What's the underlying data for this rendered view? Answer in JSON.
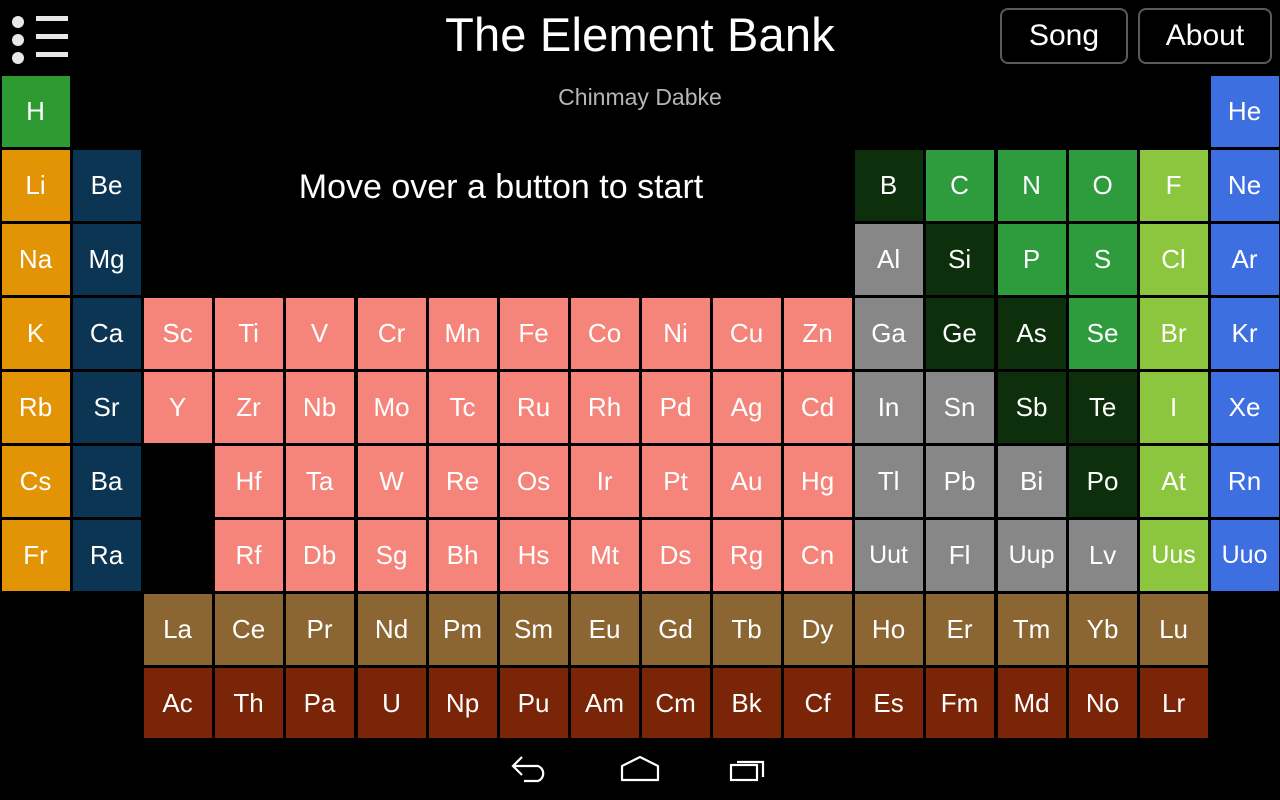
{
  "app": {
    "title": "The Element Bank",
    "subtitle": "Chinmay Dabke",
    "hint": "Move over a button to start"
  },
  "header": {
    "menu_icon": "list-menu-icon",
    "song_label": "Song",
    "about_label": "About"
  },
  "navbar": {
    "back_label": "Back",
    "home_label": "Home",
    "recents_label": "Recent apps"
  },
  "legend_colors": {
    "hydrogen": "#2E9B32",
    "alkali_metal": "#E29405",
    "alkaline_earth": "#0C3553",
    "transition_metal": "#F5857A",
    "post_transition_metal": "#878787",
    "metalloid": "#0D2F0C",
    "nonmetal": "#2E9B3C",
    "halogen": "#8CC63E",
    "noble_gas": "#3E6FE0",
    "lanthanide": "#8B6633",
    "actinide": "#7A2408",
    "background": "#000000",
    "text": "#FFFFFF"
  },
  "chart_data": {
    "type": "table",
    "title": "Periodic Table of the Elements",
    "columns": 18,
    "rows": 7,
    "fblock_rows": 2,
    "elements": [
      {
        "symbol": "H",
        "col": 1,
        "row": 1,
        "category": "hydrogen"
      },
      {
        "symbol": "He",
        "col": 18,
        "row": 1,
        "category": "noble_gas"
      },
      {
        "symbol": "Li",
        "col": 1,
        "row": 2,
        "category": "alkali_metal"
      },
      {
        "symbol": "Be",
        "col": 2,
        "row": 2,
        "category": "alkaline_earth"
      },
      {
        "symbol": "B",
        "col": 13,
        "row": 2,
        "category": "metalloid"
      },
      {
        "symbol": "C",
        "col": 14,
        "row": 2,
        "category": "nonmetal"
      },
      {
        "symbol": "N",
        "col": 15,
        "row": 2,
        "category": "nonmetal"
      },
      {
        "symbol": "O",
        "col": 16,
        "row": 2,
        "category": "nonmetal"
      },
      {
        "symbol": "F",
        "col": 17,
        "row": 2,
        "category": "halogen"
      },
      {
        "symbol": "Ne",
        "col": 18,
        "row": 2,
        "category": "noble_gas"
      },
      {
        "symbol": "Na",
        "col": 1,
        "row": 3,
        "category": "alkali_metal"
      },
      {
        "symbol": "Mg",
        "col": 2,
        "row": 3,
        "category": "alkaline_earth"
      },
      {
        "symbol": "Al",
        "col": 13,
        "row": 3,
        "category": "post_transition_metal"
      },
      {
        "symbol": "Si",
        "col": 14,
        "row": 3,
        "category": "metalloid"
      },
      {
        "symbol": "P",
        "col": 15,
        "row": 3,
        "category": "nonmetal"
      },
      {
        "symbol": "S",
        "col": 16,
        "row": 3,
        "category": "nonmetal"
      },
      {
        "symbol": "Cl",
        "col": 17,
        "row": 3,
        "category": "halogen"
      },
      {
        "symbol": "Ar",
        "col": 18,
        "row": 3,
        "category": "noble_gas"
      },
      {
        "symbol": "K",
        "col": 1,
        "row": 4,
        "category": "alkali_metal"
      },
      {
        "symbol": "Ca",
        "col": 2,
        "row": 4,
        "category": "alkaline_earth"
      },
      {
        "symbol": "Sc",
        "col": 3,
        "row": 4,
        "category": "transition_metal"
      },
      {
        "symbol": "Ti",
        "col": 4,
        "row": 4,
        "category": "transition_metal"
      },
      {
        "symbol": "V",
        "col": 5,
        "row": 4,
        "category": "transition_metal"
      },
      {
        "symbol": "Cr",
        "col": 6,
        "row": 4,
        "category": "transition_metal"
      },
      {
        "symbol": "Mn",
        "col": 7,
        "row": 4,
        "category": "transition_metal"
      },
      {
        "symbol": "Fe",
        "col": 8,
        "row": 4,
        "category": "transition_metal"
      },
      {
        "symbol": "Co",
        "col": 9,
        "row": 4,
        "category": "transition_metal"
      },
      {
        "symbol": "Ni",
        "col": 10,
        "row": 4,
        "category": "transition_metal"
      },
      {
        "symbol": "Cu",
        "col": 11,
        "row": 4,
        "category": "transition_metal"
      },
      {
        "symbol": "Zn",
        "col": 12,
        "row": 4,
        "category": "transition_metal"
      },
      {
        "symbol": "Ga",
        "col": 13,
        "row": 4,
        "category": "post_transition_metal"
      },
      {
        "symbol": "Ge",
        "col": 14,
        "row": 4,
        "category": "metalloid"
      },
      {
        "symbol": "As",
        "col": 15,
        "row": 4,
        "category": "metalloid"
      },
      {
        "symbol": "Se",
        "col": 16,
        "row": 4,
        "category": "nonmetal"
      },
      {
        "symbol": "Br",
        "col": 17,
        "row": 4,
        "category": "halogen"
      },
      {
        "symbol": "Kr",
        "col": 18,
        "row": 4,
        "category": "noble_gas"
      },
      {
        "symbol": "Rb",
        "col": 1,
        "row": 5,
        "category": "alkali_metal"
      },
      {
        "symbol": "Sr",
        "col": 2,
        "row": 5,
        "category": "alkaline_earth"
      },
      {
        "symbol": "Y",
        "col": 3,
        "row": 5,
        "category": "transition_metal"
      },
      {
        "symbol": "Zr",
        "col": 4,
        "row": 5,
        "category": "transition_metal"
      },
      {
        "symbol": "Nb",
        "col": 5,
        "row": 5,
        "category": "transition_metal"
      },
      {
        "symbol": "Mo",
        "col": 6,
        "row": 5,
        "category": "transition_metal"
      },
      {
        "symbol": "Tc",
        "col": 7,
        "row": 5,
        "category": "transition_metal"
      },
      {
        "symbol": "Ru",
        "col": 8,
        "row": 5,
        "category": "transition_metal"
      },
      {
        "symbol": "Rh",
        "col": 9,
        "row": 5,
        "category": "transition_metal"
      },
      {
        "symbol": "Pd",
        "col": 10,
        "row": 5,
        "category": "transition_metal"
      },
      {
        "symbol": "Ag",
        "col": 11,
        "row": 5,
        "category": "transition_metal"
      },
      {
        "symbol": "Cd",
        "col": 12,
        "row": 5,
        "category": "transition_metal"
      },
      {
        "symbol": "In",
        "col": 13,
        "row": 5,
        "category": "post_transition_metal"
      },
      {
        "symbol": "Sn",
        "col": 14,
        "row": 5,
        "category": "post_transition_metal"
      },
      {
        "symbol": "Sb",
        "col": 15,
        "row": 5,
        "category": "metalloid"
      },
      {
        "symbol": "Te",
        "col": 16,
        "row": 5,
        "category": "metalloid"
      },
      {
        "symbol": "I",
        "col": 17,
        "row": 5,
        "category": "halogen"
      },
      {
        "symbol": "Xe",
        "col": 18,
        "row": 5,
        "category": "noble_gas"
      },
      {
        "symbol": "Cs",
        "col": 1,
        "row": 6,
        "category": "alkali_metal"
      },
      {
        "symbol": "Ba",
        "col": 2,
        "row": 6,
        "category": "alkaline_earth"
      },
      {
        "symbol": "Hf",
        "col": 4,
        "row": 6,
        "category": "transition_metal"
      },
      {
        "symbol": "Ta",
        "col": 5,
        "row": 6,
        "category": "transition_metal"
      },
      {
        "symbol": "W",
        "col": 6,
        "row": 6,
        "category": "transition_metal"
      },
      {
        "symbol": "Re",
        "col": 7,
        "row": 6,
        "category": "transition_metal"
      },
      {
        "symbol": "Os",
        "col": 8,
        "row": 6,
        "category": "transition_metal"
      },
      {
        "symbol": "Ir",
        "col": 9,
        "row": 6,
        "category": "transition_metal"
      },
      {
        "symbol": "Pt",
        "col": 10,
        "row": 6,
        "category": "transition_metal"
      },
      {
        "symbol": "Au",
        "col": 11,
        "row": 6,
        "category": "transition_metal"
      },
      {
        "symbol": "Hg",
        "col": 12,
        "row": 6,
        "category": "transition_metal"
      },
      {
        "symbol": "Tl",
        "col": 13,
        "row": 6,
        "category": "post_transition_metal"
      },
      {
        "symbol": "Pb",
        "col": 14,
        "row": 6,
        "category": "post_transition_metal"
      },
      {
        "symbol": "Bi",
        "col": 15,
        "row": 6,
        "category": "post_transition_metal"
      },
      {
        "symbol": "Po",
        "col": 16,
        "row": 6,
        "category": "metalloid"
      },
      {
        "symbol": "At",
        "col": 17,
        "row": 6,
        "category": "halogen"
      },
      {
        "symbol": "Rn",
        "col": 18,
        "row": 6,
        "category": "noble_gas"
      },
      {
        "symbol": "Fr",
        "col": 1,
        "row": 7,
        "category": "alkali_metal"
      },
      {
        "symbol": "Ra",
        "col": 2,
        "row": 7,
        "category": "alkaline_earth"
      },
      {
        "symbol": "Rf",
        "col": 4,
        "row": 7,
        "category": "transition_metal"
      },
      {
        "symbol": "Db",
        "col": 5,
        "row": 7,
        "category": "transition_metal"
      },
      {
        "symbol": "Sg",
        "col": 6,
        "row": 7,
        "category": "transition_metal"
      },
      {
        "symbol": "Bh",
        "col": 7,
        "row": 7,
        "category": "transition_metal"
      },
      {
        "symbol": "Hs",
        "col": 8,
        "row": 7,
        "category": "transition_metal"
      },
      {
        "symbol": "Mt",
        "col": 9,
        "row": 7,
        "category": "transition_metal"
      },
      {
        "symbol": "Ds",
        "col": 10,
        "row": 7,
        "category": "transition_metal"
      },
      {
        "symbol": "Rg",
        "col": 11,
        "row": 7,
        "category": "transition_metal"
      },
      {
        "symbol": "Cn",
        "col": 12,
        "row": 7,
        "category": "transition_metal"
      },
      {
        "symbol": "Uut",
        "col": 13,
        "row": 7,
        "category": "post_transition_metal"
      },
      {
        "symbol": "Fl",
        "col": 14,
        "row": 7,
        "category": "post_transition_metal"
      },
      {
        "symbol": "Uup",
        "col": 15,
        "row": 7,
        "category": "post_transition_metal"
      },
      {
        "symbol": "Lv",
        "col": 16,
        "row": 7,
        "category": "post_transition_metal"
      },
      {
        "symbol": "Uus",
        "col": 17,
        "row": 7,
        "category": "halogen"
      },
      {
        "symbol": "Uuo",
        "col": 18,
        "row": 7,
        "category": "noble_gas"
      },
      {
        "symbol": "La",
        "col": 3,
        "row": 8,
        "category": "lanthanide"
      },
      {
        "symbol": "Ce",
        "col": 4,
        "row": 8,
        "category": "lanthanide"
      },
      {
        "symbol": "Pr",
        "col": 5,
        "row": 8,
        "category": "lanthanide"
      },
      {
        "symbol": "Nd",
        "col": 6,
        "row": 8,
        "category": "lanthanide"
      },
      {
        "symbol": "Pm",
        "col": 7,
        "row": 8,
        "category": "lanthanide"
      },
      {
        "symbol": "Sm",
        "col": 8,
        "row": 8,
        "category": "lanthanide"
      },
      {
        "symbol": "Eu",
        "col": 9,
        "row": 8,
        "category": "lanthanide"
      },
      {
        "symbol": "Gd",
        "col": 10,
        "row": 8,
        "category": "lanthanide"
      },
      {
        "symbol": "Tb",
        "col": 11,
        "row": 8,
        "category": "lanthanide"
      },
      {
        "symbol": "Dy",
        "col": 12,
        "row": 8,
        "category": "lanthanide"
      },
      {
        "symbol": "Ho",
        "col": 13,
        "row": 8,
        "category": "lanthanide"
      },
      {
        "symbol": "Er",
        "col": 14,
        "row": 8,
        "category": "lanthanide"
      },
      {
        "symbol": "Tm",
        "col": 15,
        "row": 8,
        "category": "lanthanide"
      },
      {
        "symbol": "Yb",
        "col": 16,
        "row": 8,
        "category": "lanthanide"
      },
      {
        "symbol": "Lu",
        "col": 17,
        "row": 8,
        "category": "lanthanide"
      },
      {
        "symbol": "Ac",
        "col": 3,
        "row": 9,
        "category": "actinide"
      },
      {
        "symbol": "Th",
        "col": 4,
        "row": 9,
        "category": "actinide"
      },
      {
        "symbol": "Pa",
        "col": 5,
        "row": 9,
        "category": "actinide"
      },
      {
        "symbol": "U",
        "col": 6,
        "row": 9,
        "category": "actinide"
      },
      {
        "symbol": "Np",
        "col": 7,
        "row": 9,
        "category": "actinide"
      },
      {
        "symbol": "Pu",
        "col": 8,
        "row": 9,
        "category": "actinide"
      },
      {
        "symbol": "Am",
        "col": 9,
        "row": 9,
        "category": "actinide"
      },
      {
        "symbol": "Cm",
        "col": 10,
        "row": 9,
        "category": "actinide"
      },
      {
        "symbol": "Bk",
        "col": 11,
        "row": 9,
        "category": "actinide"
      },
      {
        "symbol": "Cf",
        "col": 12,
        "row": 9,
        "category": "actinide"
      },
      {
        "symbol": "Es",
        "col": 13,
        "row": 9,
        "category": "actinide"
      },
      {
        "symbol": "Fm",
        "col": 14,
        "row": 9,
        "category": "actinide"
      },
      {
        "symbol": "Md",
        "col": 15,
        "row": 9,
        "category": "actinide"
      },
      {
        "symbol": "No",
        "col": 16,
        "row": 9,
        "category": "actinide"
      },
      {
        "symbol": "Lr",
        "col": 17,
        "row": 9,
        "category": "actinide"
      }
    ]
  }
}
